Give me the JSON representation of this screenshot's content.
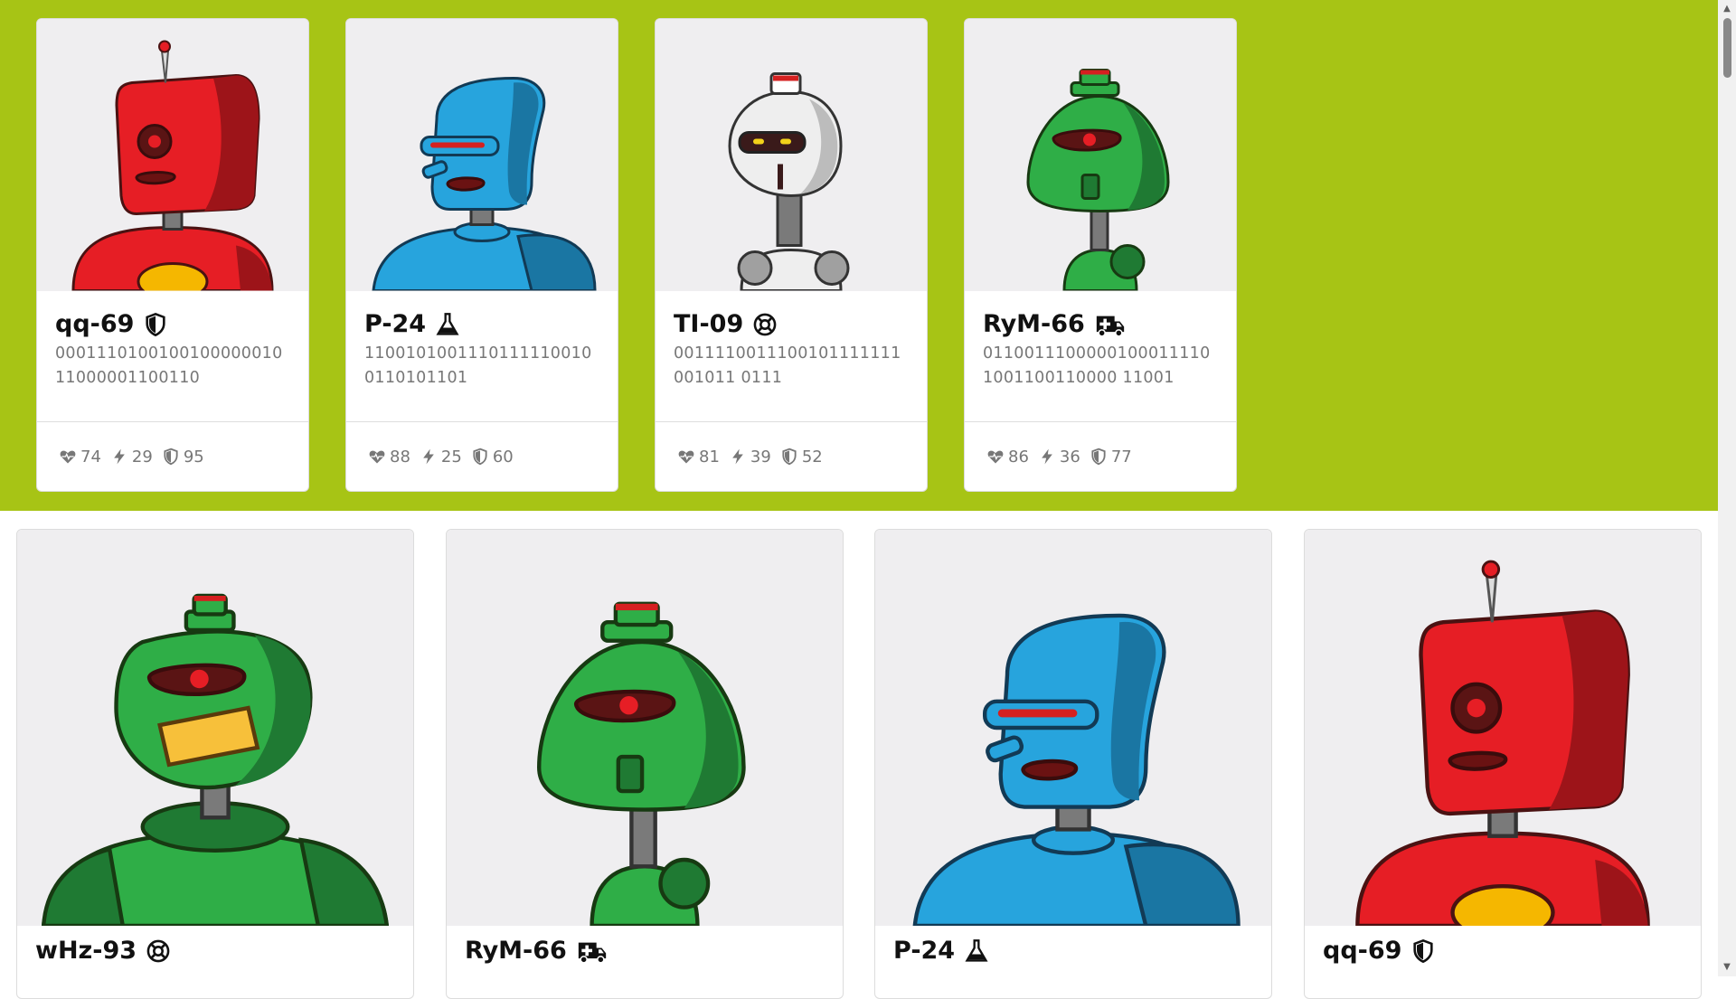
{
  "colors": {
    "band": "#a7c415",
    "red": "#e61e25",
    "blue": "#27a4dd",
    "green": "#2fae47",
    "silver": "#e4e4e4"
  },
  "top_cards": [
    {
      "name": "qq-69",
      "role_icon": "shield-icon",
      "code": "000111010010010000001011000001100110",
      "stats": {
        "health": "74",
        "energy": "29",
        "defense": "95"
      },
      "robot": "red"
    },
    {
      "name": "P-24",
      "role_icon": "scientist-icon",
      "code": "11001010011101111100100110101101",
      "stats": {
        "health": "88",
        "energy": "25",
        "defense": "60"
      },
      "robot": "blue"
    },
    {
      "name": "TI-09",
      "role_icon": "lifebuoy-icon",
      "code": "0011110011100101111111001011 0111",
      "stats": {
        "health": "81",
        "energy": "39",
        "defense": "52"
      },
      "robot": "silver"
    },
    {
      "name": "RyM-66",
      "role_icon": "ambulance-icon",
      "code": "01100111000001000111101001100110000 11001",
      "stats": {
        "health": "86",
        "energy": "36",
        "defense": "77"
      },
      "robot": "green"
    }
  ],
  "bottom_cards": [
    {
      "name": "wHz-93",
      "role_icon": "lifebuoy-icon",
      "robot": "green-grin"
    },
    {
      "name": "RyM-66",
      "role_icon": "ambulance-icon",
      "robot": "green"
    },
    {
      "name": "P-24",
      "role_icon": "scientist-icon",
      "robot": "blue"
    },
    {
      "name": "qq-69",
      "role_icon": "shield-icon",
      "robot": "red"
    }
  ]
}
